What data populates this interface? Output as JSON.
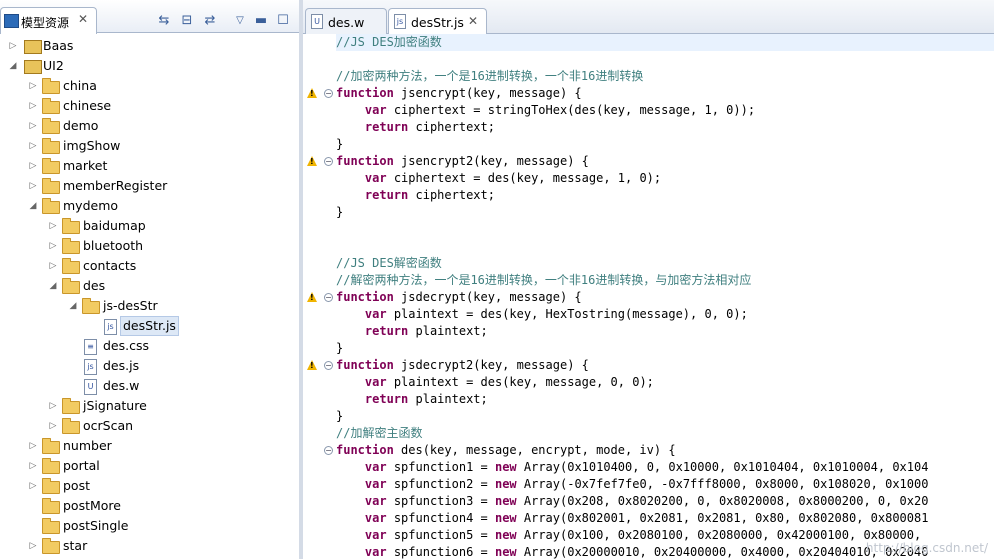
{
  "left_panel": {
    "tab_title": "模型资源",
    "toolbar_icons": [
      "sync-icon",
      "collapse-all-icon",
      "link-editor-icon",
      "view-menu-icon",
      "minimize-icon",
      "maximize-icon"
    ],
    "tree": [
      {
        "label": "Baas",
        "type": "project",
        "depth": 0,
        "arrow": "collapsed"
      },
      {
        "label": "UI2",
        "type": "project",
        "depth": 0,
        "arrow": "expanded"
      },
      {
        "label": "china",
        "type": "folder",
        "depth": 1,
        "arrow": "collapsed"
      },
      {
        "label": "chinese",
        "type": "folder",
        "depth": 1,
        "arrow": "collapsed"
      },
      {
        "label": "demo",
        "type": "folder",
        "depth": 1,
        "arrow": "collapsed"
      },
      {
        "label": "imgShow",
        "type": "folder",
        "depth": 1,
        "arrow": "collapsed"
      },
      {
        "label": "market",
        "type": "folder",
        "depth": 1,
        "arrow": "collapsed"
      },
      {
        "label": "memberRegister",
        "type": "folder",
        "depth": 1,
        "arrow": "collapsed"
      },
      {
        "label": "mydemo",
        "type": "folder",
        "depth": 1,
        "arrow": "expanded"
      },
      {
        "label": "baidumap",
        "type": "folder",
        "depth": 2,
        "arrow": "collapsed"
      },
      {
        "label": "bluetooth",
        "type": "folder",
        "depth": 2,
        "arrow": "collapsed"
      },
      {
        "label": "contacts",
        "type": "folder",
        "depth": 2,
        "arrow": "collapsed"
      },
      {
        "label": "des",
        "type": "folder",
        "depth": 2,
        "arrow": "expanded"
      },
      {
        "label": "js-desStr",
        "type": "folder",
        "depth": 3,
        "arrow": "expanded"
      },
      {
        "label": "desStr.js",
        "type": "file",
        "depth": 4,
        "arrow": "none",
        "glyph": "js",
        "selected": true
      },
      {
        "label": "des.css",
        "type": "file",
        "depth": 3,
        "arrow": "none",
        "glyph": "≡"
      },
      {
        "label": "des.js",
        "type": "file",
        "depth": 3,
        "arrow": "none",
        "glyph": "js"
      },
      {
        "label": "des.w",
        "type": "file",
        "depth": 3,
        "arrow": "none",
        "glyph": "U"
      },
      {
        "label": "jSignature",
        "type": "folder",
        "depth": 2,
        "arrow": "collapsed"
      },
      {
        "label": "ocrScan",
        "type": "folder",
        "depth": 2,
        "arrow": "collapsed"
      },
      {
        "label": "number",
        "type": "folder",
        "depth": 1,
        "arrow": "collapsed"
      },
      {
        "label": "portal",
        "type": "folder",
        "depth": 1,
        "arrow": "collapsed"
      },
      {
        "label": "post",
        "type": "folder",
        "depth": 1,
        "arrow": "collapsed"
      },
      {
        "label": "postMore",
        "type": "folder",
        "depth": 1,
        "arrow": "none"
      },
      {
        "label": "postSingle",
        "type": "folder",
        "depth": 1,
        "arrow": "none"
      },
      {
        "label": "star",
        "type": "folder",
        "depth": 1,
        "arrow": "collapsed"
      }
    ]
  },
  "editor": {
    "tabs": [
      {
        "label": "des.w",
        "glyph": "U",
        "active": false
      },
      {
        "label": "desStr.js",
        "glyph": "js",
        "active": true
      }
    ],
    "lines": [
      {
        "text": "//JS DES加密函数",
        "kind": "comment"
      },
      {
        "text": "",
        "kind": "plain"
      },
      {
        "text": "//加密两种方法，一个是16进制转换，一个非16进制转换",
        "kind": "comment"
      },
      {
        "text": "function jsencrypt(key, message) {",
        "kind": "function",
        "warn": true,
        "fold": true
      },
      {
        "text": "    var ciphertext = stringToHex(des(key, message, 1, 0));",
        "kind": "var"
      },
      {
        "text": "    return ciphertext;",
        "kind": "return"
      },
      {
        "text": "}",
        "kind": "plain"
      },
      {
        "text": "function jsencrypt2(key, message) {",
        "kind": "function",
        "warn": true,
        "fold": true
      },
      {
        "text": "    var ciphertext = des(key, message, 1, 0);",
        "kind": "var"
      },
      {
        "text": "    return ciphertext;",
        "kind": "return"
      },
      {
        "text": "}",
        "kind": "plain"
      },
      {
        "text": "",
        "kind": "plain"
      },
      {
        "text": "",
        "kind": "plain"
      },
      {
        "text": "//JS DES解密函数",
        "kind": "comment"
      },
      {
        "text": "//解密两种方法，一个是16进制转换，一个非16进制转换，与加密方法相对应",
        "kind": "comment"
      },
      {
        "text": "function jsdecrypt(key, message) {",
        "kind": "function",
        "warn": true,
        "fold": true
      },
      {
        "text": "    var plaintext = des(key, HexTostring(message), 0, 0);",
        "kind": "var"
      },
      {
        "text": "    return plaintext;",
        "kind": "return"
      },
      {
        "text": "}",
        "kind": "plain"
      },
      {
        "text": "function jsdecrypt2(key, message) {",
        "kind": "function",
        "warn": true,
        "fold": true
      },
      {
        "text": "    var plaintext = des(key, message, 0, 0);",
        "kind": "var"
      },
      {
        "text": "    return plaintext;",
        "kind": "return"
      },
      {
        "text": "}",
        "kind": "plain"
      },
      {
        "text": "//加解密主函数",
        "kind": "comment"
      },
      {
        "text": "function des(key, message, encrypt, mode, iv) {",
        "kind": "function",
        "warn": false,
        "fold": true
      },
      {
        "text": "    var spfunction1 = new Array(0x1010400, 0, 0x10000, 0x1010404, 0x1010004, 0x104",
        "kind": "array"
      },
      {
        "text": "    var spfunction2 = new Array(-0x7fef7fe0, -0x7fff8000, 0x8000, 0x108020, 0x1000",
        "kind": "array"
      },
      {
        "text": "    var spfunction3 = new Array(0x208, 0x8020200, 0, 0x8020008, 0x8000200, 0, 0x20",
        "kind": "array"
      },
      {
        "text": "    var spfunction4 = new Array(0x802001, 0x2081, 0x2081, 0x80, 0x802080, 0x800081",
        "kind": "array"
      },
      {
        "text": "    var spfunction5 = new Array(0x100, 0x2080100, 0x2080000, 0x42000100, 0x80000,",
        "kind": "array"
      },
      {
        "text": "    var spfunction6 = new Array(0x20000010, 0x20400000, 0x4000, 0x20404010, 0x2040",
        "kind": "array"
      }
    ],
    "watermark": "http://blog.csdn.net/"
  }
}
